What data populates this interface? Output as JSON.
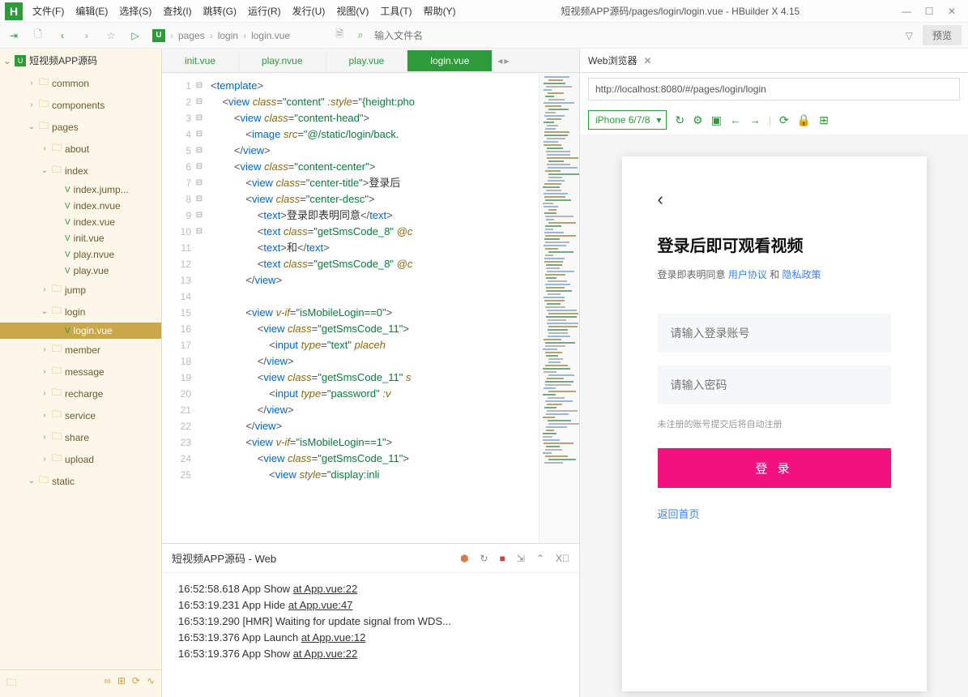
{
  "window": {
    "title": "短视频APP源码/pages/login/login.vue - HBuilder X 4.15"
  },
  "menu": [
    "文件(F)",
    "编辑(E)",
    "选择(S)",
    "查找(I)",
    "跳转(G)",
    "运行(R)",
    "发行(U)",
    "视图(V)",
    "工具(T)",
    "帮助(Y)"
  ],
  "toolbar": {
    "breadcrumb": [
      "pages",
      "login",
      "login.vue"
    ],
    "search_placeholder": "输入文件名",
    "preview_label": "预览"
  },
  "sidebar": {
    "project": "短视频APP源码",
    "items": [
      {
        "depth": 1,
        "chev": "›",
        "icon": "folder",
        "label": "common"
      },
      {
        "depth": 1,
        "chev": "›",
        "icon": "folder",
        "label": "components"
      },
      {
        "depth": 1,
        "chev": "⌄",
        "icon": "folder",
        "label": "pages"
      },
      {
        "depth": 2,
        "chev": "›",
        "icon": "folder",
        "label": "about"
      },
      {
        "depth": 2,
        "chev": "⌄",
        "icon": "folder",
        "label": "index"
      },
      {
        "depth": 3,
        "chev": "",
        "icon": "file",
        "label": "index.jump..."
      },
      {
        "depth": 3,
        "chev": "",
        "icon": "file",
        "label": "index.nvue"
      },
      {
        "depth": 3,
        "chev": "",
        "icon": "file",
        "label": "index.vue"
      },
      {
        "depth": 3,
        "chev": "",
        "icon": "file",
        "label": "init.vue"
      },
      {
        "depth": 3,
        "chev": "",
        "icon": "file",
        "label": "play.nvue"
      },
      {
        "depth": 3,
        "chev": "",
        "icon": "file",
        "label": "play.vue"
      },
      {
        "depth": 2,
        "chev": "›",
        "icon": "folder",
        "label": "jump"
      },
      {
        "depth": 2,
        "chev": "⌄",
        "icon": "folder",
        "label": "login"
      },
      {
        "depth": 3,
        "chev": "",
        "icon": "file",
        "label": "login.vue",
        "selected": true
      },
      {
        "depth": 2,
        "chev": "›",
        "icon": "folder",
        "label": "member"
      },
      {
        "depth": 2,
        "chev": "›",
        "icon": "folder",
        "label": "message"
      },
      {
        "depth": 2,
        "chev": "›",
        "icon": "folder",
        "label": "recharge"
      },
      {
        "depth": 2,
        "chev": "›",
        "icon": "folder",
        "label": "service"
      },
      {
        "depth": 2,
        "chev": "›",
        "icon": "folder",
        "label": "share"
      },
      {
        "depth": 2,
        "chev": "›",
        "icon": "folder",
        "label": "upload"
      },
      {
        "depth": 1,
        "chev": "⌄",
        "icon": "folder",
        "label": "static"
      }
    ]
  },
  "tabs": [
    "init.vue",
    "play.nvue",
    "play.vue",
    "login.vue"
  ],
  "active_tab": "login.vue",
  "code_lines": [
    {
      "n": 1,
      "fold": "⊟",
      "html": "<span class='t-punct'>&lt;</span><span class='t-tag'>template</span><span class='t-punct'>&gt;</span>"
    },
    {
      "n": 2,
      "fold": "⊟",
      "html": "    <span class='t-punct'>&lt;</span><span class='t-tag'>view</span> <span class='t-attr'>class</span><span class='t-punct'>=</span><span class='t-str'>\"content\"</span> <span class='t-attr'>:style</span><span class='t-punct'>=</span><span class='t-str'>\"{height:pho</span>"
    },
    {
      "n": 3,
      "fold": "⊟",
      "html": "        <span class='t-punct'>&lt;</span><span class='t-tag'>view</span> <span class='t-attr'>class</span><span class='t-punct'>=</span><span class='t-str'>\"content-head\"</span><span class='t-punct'>&gt;</span>"
    },
    {
      "n": 4,
      "fold": "",
      "html": "            <span class='t-punct'>&lt;</span><span class='t-tag'>image</span> <span class='t-attr'>src</span><span class='t-punct'>=</span><span class='t-str'>\"@/static/login/back.</span>"
    },
    {
      "n": 5,
      "fold": "",
      "html": "        <span class='t-punct'>&lt;/</span><span class='t-tag'>view</span><span class='t-punct'>&gt;</span>"
    },
    {
      "n": 6,
      "fold": "⊟",
      "html": "        <span class='t-punct'>&lt;</span><span class='t-tag'>view</span> <span class='t-attr'>class</span><span class='t-punct'>=</span><span class='t-str'>\"content-center\"</span><span class='t-punct'>&gt;</span>"
    },
    {
      "n": 7,
      "fold": "",
      "html": "            <span class='t-punct'>&lt;</span><span class='t-tag'>view</span> <span class='t-attr'>class</span><span class='t-punct'>=</span><span class='t-str'>\"center-title\"</span><span class='t-punct'>&gt;</span><span class='t-text'>登录后</span>"
    },
    {
      "n": 8,
      "fold": "⊟",
      "html": "            <span class='t-punct'>&lt;</span><span class='t-tag'>view</span> <span class='t-attr'>class</span><span class='t-punct'>=</span><span class='t-str'>\"center-desc\"</span><span class='t-punct'>&gt;</span>"
    },
    {
      "n": 9,
      "fold": "",
      "html": "                <span class='t-punct'>&lt;</span><span class='t-tag'>text</span><span class='t-punct'>&gt;</span><span class='t-text'>登录即表明同意</span><span class='t-punct'>&lt;/</span><span class='t-tag'>text</span><span class='t-punct'>&gt;</span>"
    },
    {
      "n": 10,
      "fold": "",
      "html": "                <span class='t-punct'>&lt;</span><span class='t-tag'>text</span> <span class='t-attr'>class</span><span class='t-punct'>=</span><span class='t-str'>\"getSmsCode_8\"</span> <span class='t-attr'>@c</span>"
    },
    {
      "n": 11,
      "fold": "",
      "html": "                <span class='t-punct'>&lt;</span><span class='t-tag'>text</span><span class='t-punct'>&gt;</span><span class='t-text'>和</span><span class='t-punct'>&lt;/</span><span class='t-tag'>text</span><span class='t-punct'>&gt;</span>"
    },
    {
      "n": 12,
      "fold": "",
      "html": "                <span class='t-punct'>&lt;</span><span class='t-tag'>text</span> <span class='t-attr'>class</span><span class='t-punct'>=</span><span class='t-str'>\"getSmsCode_8\"</span> <span class='t-attr'>@c</span>"
    },
    {
      "n": 13,
      "fold": "",
      "html": "            <span class='t-punct'>&lt;/</span><span class='t-tag'>view</span><span class='t-punct'>&gt;</span>"
    },
    {
      "n": 14,
      "fold": "",
      "html": ""
    },
    {
      "n": 15,
      "fold": "⊟",
      "html": "            <span class='t-punct'>&lt;</span><span class='t-tag'>view</span> <span class='t-attr'>v-if</span><span class='t-punct'>=</span><span class='t-str'>\"isMobileLogin==0\"</span><span class='t-punct'>&gt;</span>"
    },
    {
      "n": 16,
      "fold": "⊟",
      "html": "                <span class='t-punct'>&lt;</span><span class='t-tag'>view</span> <span class='t-attr'>class</span><span class='t-punct'>=</span><span class='t-str'>\"getSmsCode_11\"</span><span class='t-punct'>&gt;</span>"
    },
    {
      "n": 17,
      "fold": "",
      "html": "                    <span class='t-punct'>&lt;</span><span class='t-tag'>input</span> <span class='t-attr'>type</span><span class='t-punct'>=</span><span class='t-str'>\"text\"</span> <span class='t-attr'>placeh</span>"
    },
    {
      "n": 18,
      "fold": "",
      "html": "                <span class='t-punct'>&lt;/</span><span class='t-tag'>view</span><span class='t-punct'>&gt;</span>"
    },
    {
      "n": 19,
      "fold": "⊟",
      "html": "                <span class='t-punct'>&lt;</span><span class='t-tag'>view</span> <span class='t-attr'>class</span><span class='t-punct'>=</span><span class='t-str'>\"getSmsCode_11\"</span> <span class='t-attr'>s</span>"
    },
    {
      "n": 20,
      "fold": "",
      "html": "                    <span class='t-punct'>&lt;</span><span class='t-tag'>input</span> <span class='t-attr'>type</span><span class='t-punct'>=</span><span class='t-str'>\"password\"</span> <span class='t-attr'>:v</span>"
    },
    {
      "n": 21,
      "fold": "",
      "html": "                <span class='t-punct'>&lt;/</span><span class='t-tag'>view</span><span class='t-punct'>&gt;</span>"
    },
    {
      "n": 22,
      "fold": "",
      "html": "            <span class='t-punct'>&lt;/</span><span class='t-tag'>view</span><span class='t-punct'>&gt;</span>"
    },
    {
      "n": 23,
      "fold": "⊟",
      "html": "            <span class='t-punct'>&lt;</span><span class='t-tag'>view</span> <span class='t-attr'>v-if</span><span class='t-punct'>=</span><span class='t-str'>\"isMobileLogin==1\"</span><span class='t-punct'>&gt;</span>"
    },
    {
      "n": 24,
      "fold": "⊟",
      "html": "                <span class='t-punct'>&lt;</span><span class='t-tag'>view</span> <span class='t-attr'>class</span><span class='t-punct'>=</span><span class='t-str'>\"getSmsCode_11\"</span><span class='t-punct'>&gt;</span>"
    },
    {
      "n": 25,
      "fold": "",
      "html": "                    <span class='t-punct'>&lt;</span><span class='t-tag'>view</span> <span class='t-attr'>style</span><span class='t-punct'>=</span><span class='t-str'>\"display:inli</span>"
    }
  ],
  "console": {
    "title": "短视频APP源码 - Web",
    "lines": [
      {
        "ts": "16:52:58.618",
        "msg": "App Show",
        "link": "at App.vue:22"
      },
      {
        "ts": "16:53:19.231",
        "msg": "App Hide",
        "link": "at App.vue:47"
      },
      {
        "ts": "16:53:19.290",
        "msg": "[HMR] Waiting for update signal from WDS...",
        "link": ""
      },
      {
        "ts": "16:53:19.376",
        "msg": "App Launch",
        "link": "at App.vue:12"
      },
      {
        "ts": "16:53:19.376",
        "msg": "App Show",
        "link": "at App.vue:22"
      }
    ]
  },
  "browser": {
    "tab_title": "Web浏览器",
    "url": "http://localhost:8080/#/pages/login/login",
    "device": "iPhone 6/7/8"
  },
  "preview": {
    "login_title": "登录后即可观看视频",
    "desc_pre": "登录即表明同意 ",
    "agreement": "用户协议",
    "desc_mid": " 和 ",
    "privacy": "隐私政策",
    "account_placeholder": "请输入登录账号",
    "password_placeholder": "请输入密码",
    "hint": "未注册的账号提交后将自动注册",
    "login_btn": "登 录",
    "back_home": "返回首页"
  }
}
